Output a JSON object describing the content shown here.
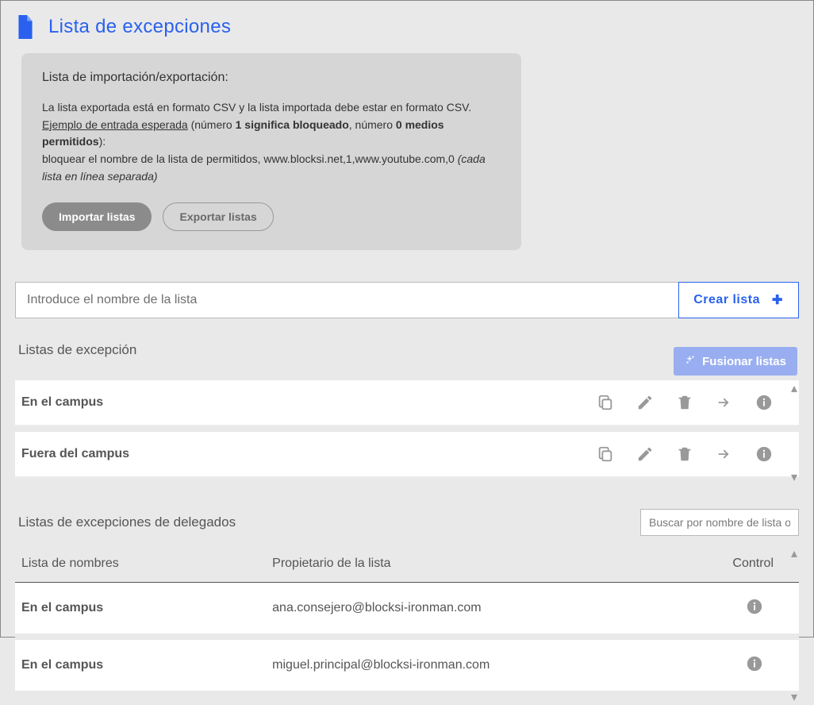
{
  "header": {
    "title": "Lista de excepciones"
  },
  "importBox": {
    "heading": "Lista de importación/exportación:",
    "line1": "La lista exportada está en formato CSV y la lista importada debe estar en formato CSV.",
    "exampleLink": "Ejemplo de entrada esperada",
    "open": " (número ",
    "bold1": "1 significa bloqueado",
    "mid1": ", número ",
    "bold2": "0 medios permitidos",
    "close": "):",
    "line3a": "bloquear el nombre de la lista de permitidos, www.blocksi.net,1,www.youtube.com,0    ",
    "line3b": "(cada lista en línea separada)",
    "importBtn": "Importar listas",
    "exportBtn": "Exportar listas"
  },
  "create": {
    "placeholder": "Introduce el nombre de la lista",
    "button": "Crear lista"
  },
  "exceptionLists": {
    "title": "Listas de excepción",
    "mergeBtn": "Fusionar listas",
    "items": [
      {
        "name": "En el campus"
      },
      {
        "name": "Fuera del campus"
      }
    ]
  },
  "delegateLists": {
    "title": "Listas de excepciones de delegados",
    "searchPlaceholder": "Buscar por nombre de lista o p",
    "columns": {
      "name": "Lista de nombres",
      "owner": "Propietario de la lista",
      "control": "Control"
    },
    "rows": [
      {
        "name": "En el campus",
        "owner": "ana.consejero@blocksi-ironman.com"
      },
      {
        "name": "En el campus",
        "owner": "miguel.principal@blocksi-ironman.com"
      }
    ]
  }
}
